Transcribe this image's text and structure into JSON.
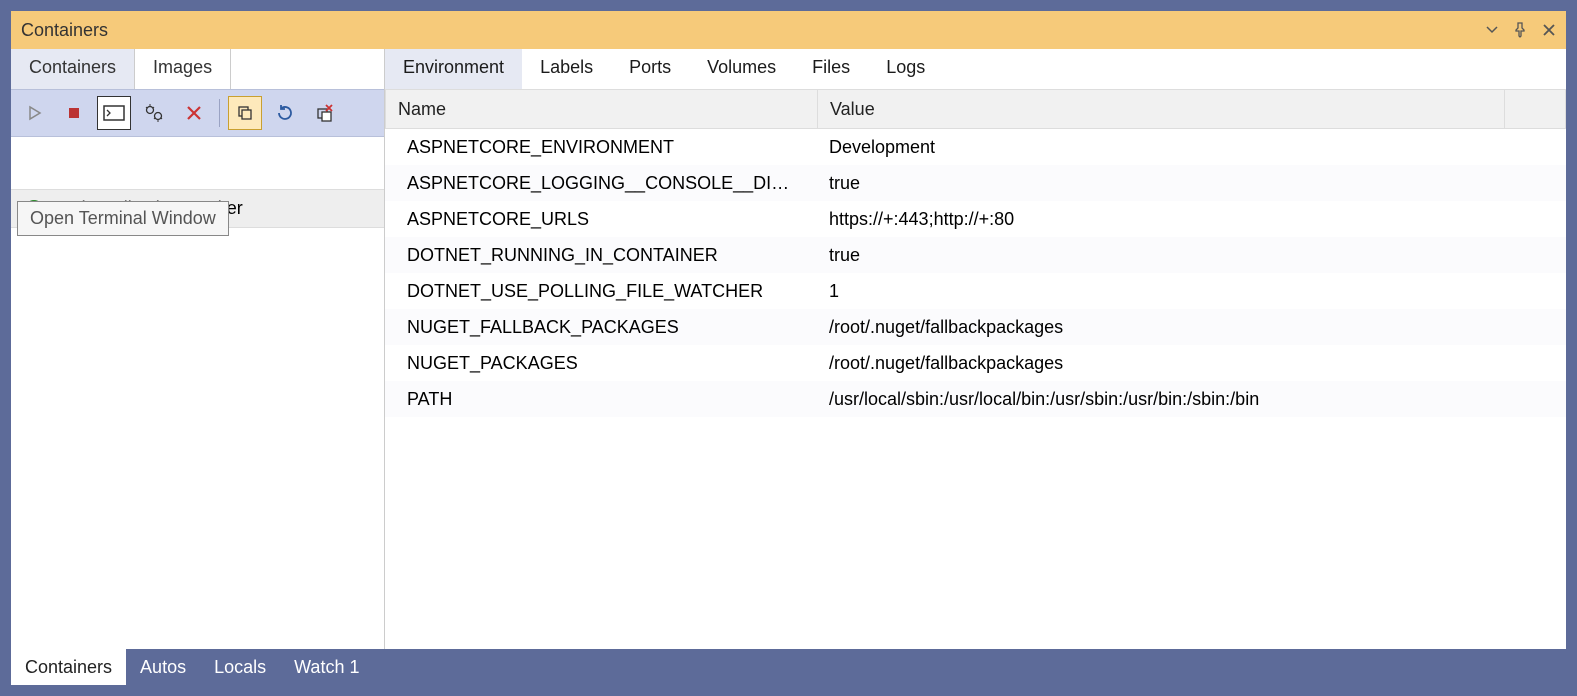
{
  "titlebar": {
    "title": "Containers"
  },
  "left": {
    "tabs": [
      {
        "label": "Containers",
        "active": true
      },
      {
        "label": "Images",
        "active": false
      }
    ],
    "tooltip": "Open Terminal Window",
    "containers": [
      {
        "name": "WebApplication-Docker",
        "running": true
      }
    ]
  },
  "right": {
    "tabs": [
      {
        "label": "Environment",
        "active": true
      },
      {
        "label": "Labels"
      },
      {
        "label": "Ports"
      },
      {
        "label": "Volumes"
      },
      {
        "label": "Files"
      },
      {
        "label": "Logs"
      }
    ],
    "columns": {
      "name": "Name",
      "value": "Value"
    },
    "rows": [
      {
        "name": "ASPNETCORE_ENVIRONMENT",
        "value": "Development"
      },
      {
        "name": "ASPNETCORE_LOGGING__CONSOLE__DISA…",
        "value": "true"
      },
      {
        "name": "ASPNETCORE_URLS",
        "value": "https://+:443;http://+:80"
      },
      {
        "name": "DOTNET_RUNNING_IN_CONTAINER",
        "value": "true"
      },
      {
        "name": "DOTNET_USE_POLLING_FILE_WATCHER",
        "value": "1"
      },
      {
        "name": "NUGET_FALLBACK_PACKAGES",
        "value": "/root/.nuget/fallbackpackages"
      },
      {
        "name": "NUGET_PACKAGES",
        "value": "/root/.nuget/fallbackpackages"
      },
      {
        "name": "PATH",
        "value": "/usr/local/sbin:/usr/local/bin:/usr/sbin:/usr/bin:/sbin:/bin"
      }
    ]
  },
  "bottom": {
    "tabs": [
      {
        "label": "Containers",
        "active": true
      },
      {
        "label": "Autos"
      },
      {
        "label": "Locals"
      },
      {
        "label": "Watch 1"
      }
    ]
  }
}
